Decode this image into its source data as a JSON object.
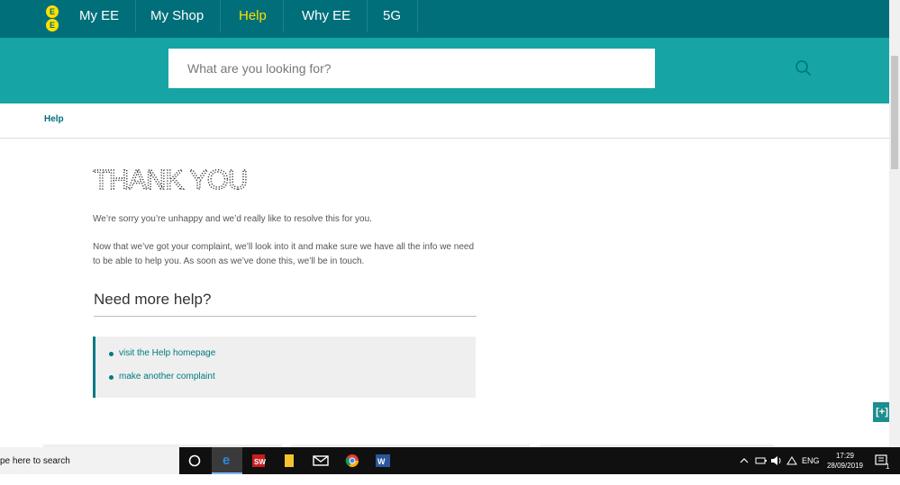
{
  "nav": {
    "logo_letters": [
      "E",
      "E"
    ],
    "items": [
      {
        "label": "My EE",
        "active": false
      },
      {
        "label": "My Shop",
        "active": false
      },
      {
        "label": "Help",
        "active": true
      },
      {
        "label": "Why EE",
        "active": false
      },
      {
        "label": "5G",
        "active": false
      }
    ]
  },
  "search": {
    "placeholder": "What are you looking for?",
    "value": ""
  },
  "breadcrumb": {
    "label": "Help"
  },
  "main": {
    "title": "THANK YOU",
    "para1": "We’re sorry you’re unhappy and we’d really like to resolve this for you.",
    "para2": "Now that we’ve got your complaint, we’ll look into it and make sure we have all the info we need to be able to help you. As soon as we’ve done this, we’ll be in touch.",
    "help_heading": "Need more help?",
    "help_links": [
      "visit the Help homepage",
      "make another complaint"
    ]
  },
  "feedback_button": {
    "label": "[+]"
  },
  "taskbar": {
    "search_placeholder": "pe here to search",
    "language": "ENG",
    "time": "17:29",
    "date": "28/09/2019",
    "notification_count": "1"
  },
  "colors": {
    "nav_bg": "#006f7a",
    "band_bg": "#16a5a4",
    "accent_yellow": "#ffe000",
    "link_teal": "#007a82"
  }
}
